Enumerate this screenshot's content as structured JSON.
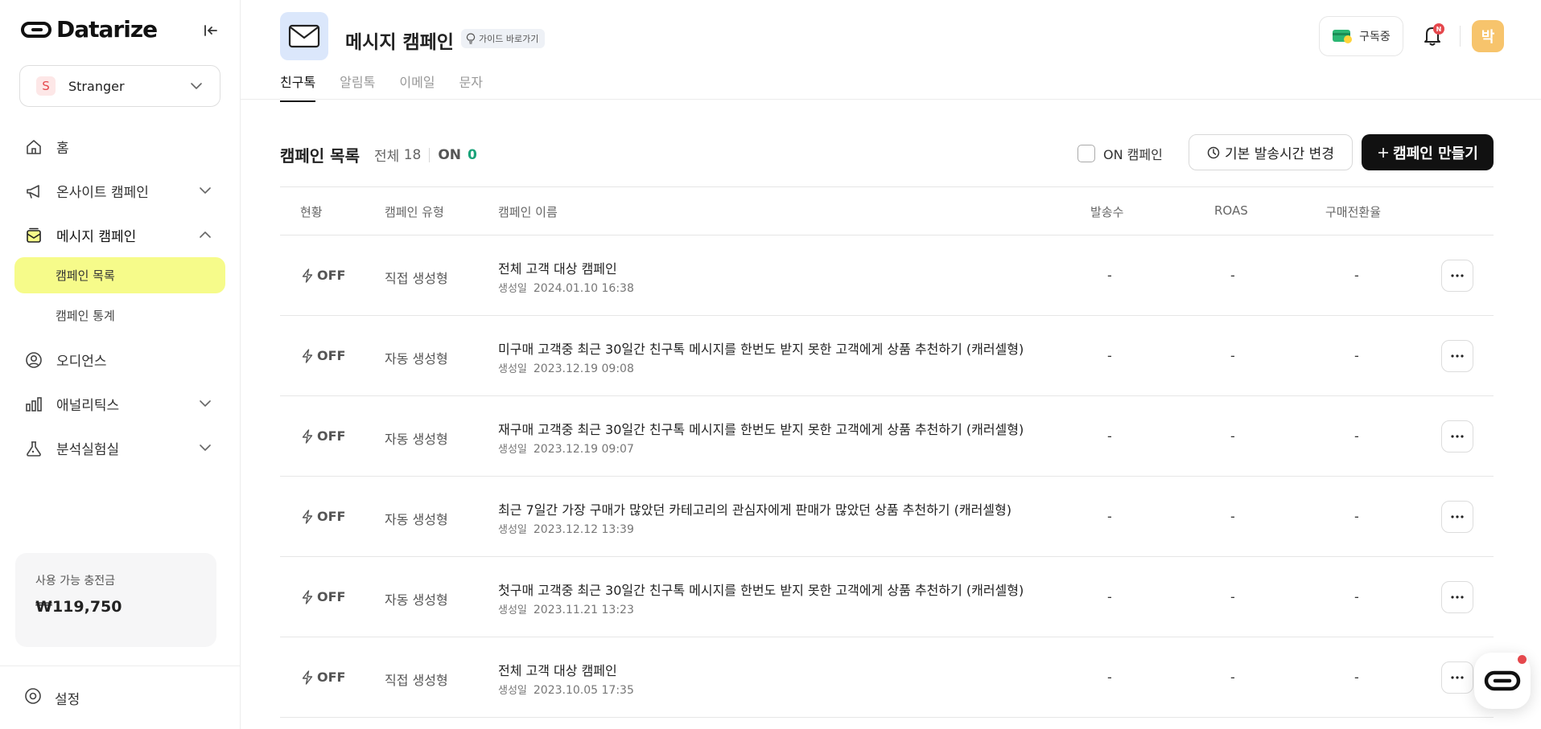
{
  "brand": {
    "name": "Datarize"
  },
  "workspace": {
    "initial": "S",
    "name": "Stranger"
  },
  "sidebar": {
    "items": [
      {
        "label": "홈"
      },
      {
        "label": "온사이트 캠페인"
      },
      {
        "label": "메시지 캠페인"
      },
      {
        "label": "오디언스"
      },
      {
        "label": "애널리틱스"
      },
      {
        "label": "분석실험실"
      }
    ],
    "sub_items": [
      {
        "label": "캠페인 목록"
      },
      {
        "label": "캠페인 통계"
      }
    ],
    "balance": {
      "label": "사용 가능 충전금",
      "value": "₩119,750"
    },
    "settings_label": "설정"
  },
  "header": {
    "title": "메시지 캠페인",
    "guide_label": "가이드 바로가기",
    "tabs": [
      {
        "label": "친구톡"
      },
      {
        "label": "알림톡"
      },
      {
        "label": "이메일"
      },
      {
        "label": "문자"
      }
    ],
    "subscribe_label": "구독중",
    "notification_badge": "N",
    "user_initial": "박"
  },
  "list": {
    "title": "캠페인 목록",
    "total_label": "전체",
    "total_count": "18",
    "on_label": "ON",
    "on_count": "0",
    "on_filter_label": "ON 캠페인",
    "time_button_label": "기본 발송시간 변경",
    "create_button_label": "캠페인 만들기",
    "columns": [
      "현황",
      "캠페인 유형",
      "캠페인 이름",
      "발송수",
      "ROAS",
      "구매전환율"
    ],
    "created_prefix": "생성일",
    "rows": [
      {
        "status": "OFF",
        "type": "직접 생성형",
        "name": "전체 고객 대상 캠페인",
        "created": "2024.01.10  16:38",
        "sends": "-",
        "roas": "-",
        "conversion": "-"
      },
      {
        "status": "OFF",
        "type": "자동 생성형",
        "name": "미구매 고객중 최근 30일간 친구톡 메시지를 한번도 받지 못한 고객에게 상품 추천하기 (캐러셀형)",
        "created": "2023.12.19  09:08",
        "sends": "-",
        "roas": "-",
        "conversion": "-"
      },
      {
        "status": "OFF",
        "type": "자동 생성형",
        "name": "재구매 고객중 최근 30일간 친구톡 메시지를 한번도 받지 못한 고객에게 상품 추천하기 (캐러셀형)",
        "created": "2023.12.19  09:07",
        "sends": "-",
        "roas": "-",
        "conversion": "-"
      },
      {
        "status": "OFF",
        "type": "자동 생성형",
        "name": "최근 7일간 가장 구매가 많았던 카테고리의 관심자에게 판매가 많았던 상품 추천하기 (캐러셀형)",
        "created": "2023.12.12  13:39",
        "sends": "-",
        "roas": "-",
        "conversion": "-"
      },
      {
        "status": "OFF",
        "type": "자동 생성형",
        "name": "첫구매 고객중 최근 30일간 친구톡 메시지를 한번도 받지 못한 고객에게 상품 추천하기 (캐러셀형)",
        "created": "2023.11.21  13:23",
        "sends": "-",
        "roas": "-",
        "conversion": "-"
      },
      {
        "status": "OFF",
        "type": "직접 생성형",
        "name": "전체 고객 대상 캠페인",
        "created": "2023.10.05  17:35",
        "sends": "-",
        "roas": "-",
        "conversion": "-"
      }
    ]
  },
  "colors": {
    "accent_highlight": "#f6fb8a",
    "on_count": "#1aa37a",
    "primary_button": "#111111",
    "badge": "#e5484d",
    "page_icon_bg": "#dbe7fb",
    "avatar": "#f7c46c"
  },
  "icons": [
    "collapse-sidebar-icon",
    "chevron-down-icon",
    "chevron-up-icon",
    "home-icon",
    "megaphone-icon",
    "mail-box-icon",
    "user-circle-icon",
    "bar-chart-icon",
    "flask-icon",
    "settings-icon",
    "mail-icon",
    "lightbulb-icon",
    "card-icon",
    "bell-icon",
    "clock-icon",
    "plus-icon",
    "lightning-icon",
    "more-icon",
    "chat-icon"
  ]
}
